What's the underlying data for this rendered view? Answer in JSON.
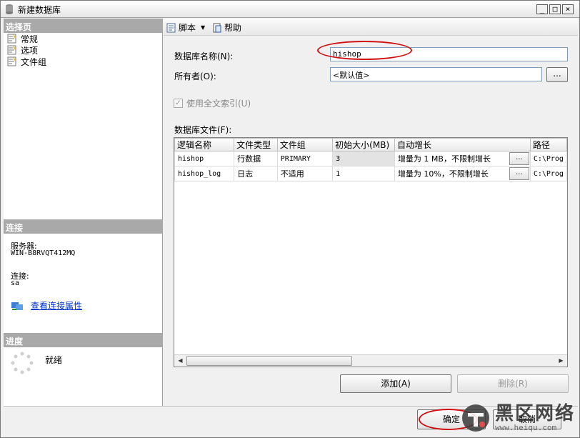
{
  "window": {
    "title": "新建数据库"
  },
  "left": {
    "select_page_header": "选择页",
    "pages": [
      {
        "label": "常规",
        "icon": "page-icon"
      },
      {
        "label": "选项",
        "icon": "page-icon"
      },
      {
        "label": "文件组",
        "icon": "page-icon"
      }
    ],
    "connection_header": "连接",
    "server_label": "服务器:",
    "server_value": "WIN-B8RVQT412MQ",
    "connection_label": "连接:",
    "connection_value": "sa",
    "view_conn_props_link": "查看连接属性",
    "progress_header": "进度",
    "progress_status": "就绪"
  },
  "toolbar": {
    "script_label": "脚本",
    "help_label": "帮助"
  },
  "form": {
    "db_name_label": "数据库名称(N):",
    "db_name_value": "hishop",
    "owner_label": "所有者(O):",
    "owner_value": "<默认值>",
    "browse_label": "...",
    "fulltext_label": "使用全文索引(U)",
    "db_files_label": "数据库文件(F):"
  },
  "files_table": {
    "columns": [
      "逻辑名称",
      "文件类型",
      "文件组",
      "初始大小(MB)",
      "自动增长",
      "路径"
    ],
    "rows": [
      [
        "hishop",
        "行数据",
        "PRIMARY",
        "3",
        "增量为 1 MB，不限制增长",
        "C:\\Prog"
      ],
      [
        "hishop_log",
        "日志",
        "不适用",
        "1",
        "增量为 10%，不限制增长",
        "C:\\Prog"
      ]
    ],
    "ellipsis": "..."
  },
  "buttons": {
    "add": "添加(A)",
    "remove": "删除(R)",
    "ok": "确定",
    "cancel": "取消"
  },
  "watermark": {
    "text": "黑区网络",
    "url": "www.heiqu.com"
  },
  "colors": {
    "annotation": "#d01010",
    "link": "#0033cc",
    "header_gray": "#a9a9a9"
  }
}
